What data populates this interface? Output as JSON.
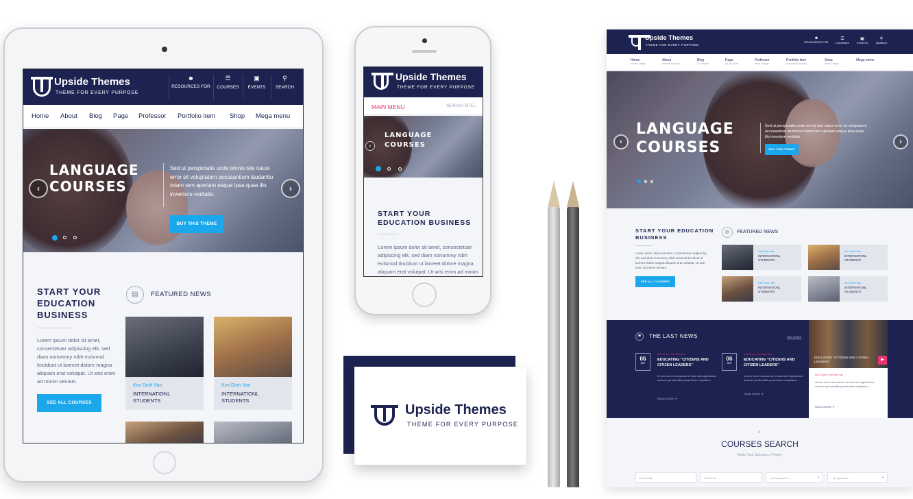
{
  "brand": {
    "name": "Upside Themes",
    "tagline": "THEME FOR EVERY PURPOSE"
  },
  "header_icons": [
    {
      "label": "RESOURCES FOR",
      "icon": "person-icon"
    },
    {
      "label": "COURSES",
      "icon": "list-icon"
    },
    {
      "label": "EVENTS",
      "icon": "calendar-icon"
    },
    {
      "label": "SEARCH",
      "icon": "search-icon"
    }
  ],
  "nav": [
    "Home",
    "About",
    "Blog",
    "Page",
    "Professor",
    "Portfolio item",
    "Shop",
    "Mega menu"
  ],
  "nav_sub": [
    "About College",
    "We talk about us",
    "Our stories",
    "All you need",
    "Meet College",
    "Successful projects",
    "Meet College",
    ""
  ],
  "hero": {
    "title_line1": "LANGUAGE",
    "title_line2": "COURSES",
    "text": "Sed ut perspiciatis unde omnis iste natus error sit voluptatem accusantium laudantiu totam rem aperiam eaque ipsa quae illo inventore veritatis.",
    "button": "BUY THIS THEME"
  },
  "intro": {
    "title": "START YOUR EDUCATION BUSINESS",
    "text": "Lorem ipsum dolor sit amet, consectetuer adipiscing elit, sed diam nonummy nibh euismod tincidunt ut laoreet dolore magna aliquam erat volutpat. Ut wisi enim ad minim veniam.",
    "button": "SEE ALL COURSES"
  },
  "featured": {
    "title": "FEATURED NEWS",
    "items": [
      {
        "author": "Kim Dinh Van",
        "title": "INTERNATIONL STUDENTS"
      },
      {
        "author": "Kim Dinh Van",
        "title": "INTERNATIONL STUDENTS"
      },
      {
        "author": "Kim Dinh Van",
        "title": "INTERNATIONL STUDENTS"
      },
      {
        "author": "Kim Dinh Van",
        "title": "INTERNATIONL STUDENTS"
      }
    ]
  },
  "mobile": {
    "main_menu": "MAIN MENU",
    "search_placeholder": "SEARCH SITE..."
  },
  "last_news": {
    "title": "THE LAST NEWS",
    "see_more": "SEE MORE",
    "items": [
      {
        "day": "06",
        "month": "SEP",
        "meta": "At 8:12 pm / Kim Dinh Van",
        "title": "EDUCATING \"CITIZENS AND CITIZEN LEADERS\"",
        "text": "At vero eos et accusamus et iusto odio dignissimos ducimus qui blanditiis praesentium voluptatum.",
        "read_more": "READ MORE"
      },
      {
        "day": "06",
        "month": "SEP",
        "meta": "At 8:12 pm / Kim Dinh Van",
        "title": "EDUCATING \"CITIZENS AND CITIZEN LEADERS\"",
        "text": "At vero eos et accusamus et iusto odio dignissimos ducimus qui blanditiis praesentium voluptatum.",
        "read_more": "READ MORE"
      }
    ],
    "video": {
      "caption": "EDUCATING \"CITIZENS AND CITIZEN LEADERS\"",
      "meta": "At 8:12 pm / Kim Dinh Van",
      "text": "At vero eos et accusamus et iusto odio dignissimos ducimus qui blanditiis praesentium voluptatum.",
      "read_more": "READ MORE"
    }
  },
  "courses_search": {
    "title": "COURSES SEARCH",
    "subtitle": "Make Your Success a Priority",
    "fields": [
      "Course title",
      "Course ID",
      "-- All categories --",
      "-- All speakers --"
    ]
  },
  "colors": {
    "navy": "#1c2350",
    "accent": "#1aa7ec",
    "pink": "#e6356f"
  }
}
